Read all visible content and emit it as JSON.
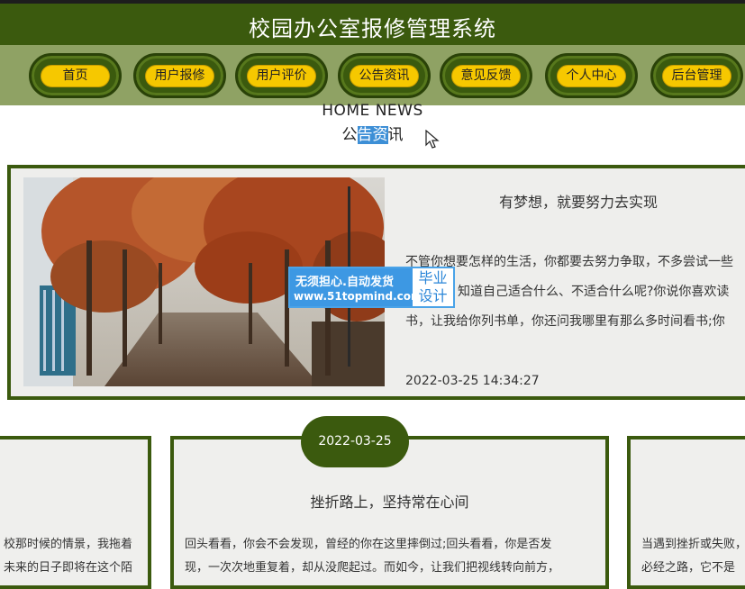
{
  "header": {
    "title": "校园办公室报修管理系统"
  },
  "nav": {
    "items": [
      {
        "label": "首页"
      },
      {
        "label": "用户报修"
      },
      {
        "label": "用户评价"
      },
      {
        "label": "公告资讯"
      },
      {
        "label": "意见反馈"
      },
      {
        "label": "个人中心"
      },
      {
        "label": "后台管理"
      }
    ]
  },
  "section": {
    "title_en": "HOME NEWS",
    "title_cn_a": "公",
    "title_cn_highlight": "告资",
    "title_cn_b": "讯"
  },
  "featured": {
    "title": "有梦想，就要努力去实现",
    "lines": [
      "不管你想要怎样的生活，你都要去努力争取，不多尝试一些",
      "知道自己适合什么、不适合什么呢?你说你喜欢读",
      "书，让我给你列书单，你还问我哪里有那么多时间看书;你"
    ],
    "date": "2022-03-25 14:34:27"
  },
  "watermark": {
    "line1": "无须担心.自动发货",
    "line2": "www.51topmind.com",
    "badge1": "毕业",
    "badge2": "设计"
  },
  "cards": {
    "date_badge": "2022-03-25",
    "left": {
      "line1": "校那时候的情景，我拖着",
      "line2": "未来的日子即将在这个陌"
    },
    "center": {
      "title": "挫折路上，坚持常在心间",
      "line1": "回头看看，你会不会发现，曾经的你在这里摔倒过;回头看看，你是否发",
      "line2": "现，一次次地重复着，却从没爬起过。而如今，让我们把视线转向前方，"
    },
    "right": {
      "line1": "当遇到挫折或失败，",
      "line2": "必经之路，它不是"
    }
  },
  "colors": {
    "dark_green": "#3b5a0e",
    "nav_green": "#8fa264",
    "pill_yellow": "#f6c800"
  }
}
